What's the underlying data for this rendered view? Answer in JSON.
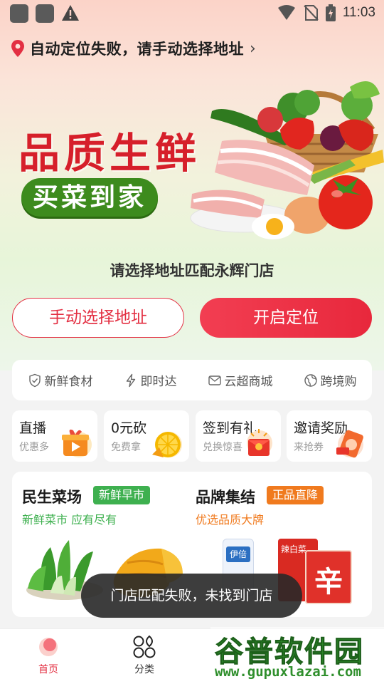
{
  "status_bar": {
    "time": "11:03"
  },
  "location": {
    "text": "自动定位失败，请手动选择地址",
    "chevron": "›"
  },
  "banner": {
    "title": "品质生鲜",
    "tagline": "买菜到家"
  },
  "prompt": "请选择地址匹配永辉门店",
  "buttons": {
    "manual": "手动选择地址",
    "locate": "开启定位"
  },
  "services": [
    {
      "label": "新鲜食材",
      "icon": "shield-check-icon"
    },
    {
      "label": "即时达",
      "icon": "lightning-icon"
    },
    {
      "label": "云超商城",
      "icon": "mail-icon"
    },
    {
      "label": "跨境购",
      "icon": "globe-icon"
    }
  ],
  "promos": [
    {
      "title": "直播",
      "subtitle": "优惠多",
      "icon": "gift-play-icon"
    },
    {
      "title": "0元砍",
      "subtitle": "免费拿",
      "icon": "orange-slice-icon"
    },
    {
      "title": "签到有礼",
      "subtitle": "兑换惊喜",
      "icon": "red-envelope-icon"
    },
    {
      "title": "邀请奖励",
      "subtitle": "来抢券",
      "icon": "coupon-card-icon"
    }
  ],
  "feature": {
    "left": {
      "title": "民生菜场",
      "tag": "新鲜早市",
      "subtitle": "新鲜菜市 应有尽有"
    },
    "right": {
      "title": "品牌集结",
      "tag": "正品直降",
      "subtitle": "优选品质大牌"
    },
    "product_labels": {
      "milk": "伊倍",
      "noodle": "辛",
      "noodle_brand": "辣白菜"
    }
  },
  "toast": "门店匹配失败，未找到门店",
  "nav": [
    {
      "label": "首页",
      "active": true
    },
    {
      "label": "分类",
      "active": false
    }
  ],
  "watermark": {
    "line1": "谷普软件园",
    "line2": "www.gupuxlazai.com"
  },
  "colors": {
    "brand_red": "#e32f42",
    "green": "#3d8b1d",
    "orange": "#f07a1e"
  }
}
